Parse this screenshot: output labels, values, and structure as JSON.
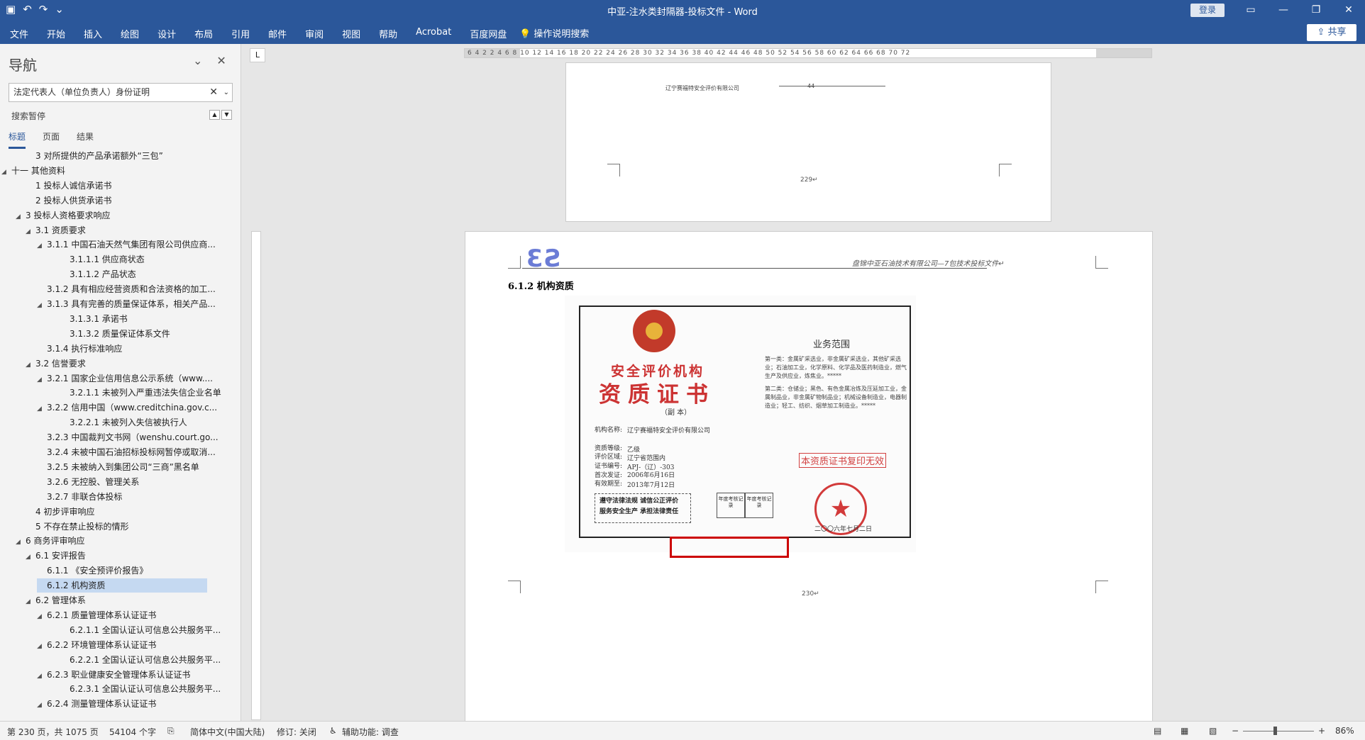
{
  "titlebar": {
    "title": "中亚-注水类封隔器-投标文件  -  Word",
    "login": "登录",
    "qat_icons": [
      "save-icon",
      "undo-icon",
      "redo-icon",
      "customize-icon"
    ],
    "controls": [
      "ribbon-display-icon",
      "minimize-icon",
      "restore-icon",
      "close-icon"
    ]
  },
  "ribbon": {
    "tabs": [
      "文件",
      "开始",
      "插入",
      "绘图",
      "设计",
      "布局",
      "引用",
      "邮件",
      "审阅",
      "视图",
      "帮助",
      "Acrobat",
      "百度网盘"
    ],
    "tellme": "操作说明搜索",
    "share": "共享"
  },
  "nav": {
    "title": "导航",
    "search_value": "法定代表人（单位负责人）身份证明",
    "paused": "搜索暂停",
    "tabs": [
      "标题",
      "页面",
      "结果"
    ],
    "items": [
      {
        "label": "3 对所提供的产品承诺额外“三包”"
      },
      {
        "label": "十一 其他资料"
      },
      {
        "label": "1 投标人诚信承诺书"
      },
      {
        "label": "2 投标人供货承诺书"
      },
      {
        "label": "3 投标人资格要求响应"
      },
      {
        "label": "3.1 资质要求"
      },
      {
        "label": "3.1.1 中国石油天然气集团有限公司供应商..."
      },
      {
        "label": "3.1.1.1 供应商状态"
      },
      {
        "label": "3.1.1.2 产品状态"
      },
      {
        "label": "3.1.2 具有相应经营资质和合法资格的加工..."
      },
      {
        "label": "3.1.3 具有完善的质量保证体系，相关产品..."
      },
      {
        "label": "3.1.3.1 承诺书"
      },
      {
        "label": "3.1.3.2 质量保证体系文件"
      },
      {
        "label": "3.1.4 执行标准响应"
      },
      {
        "label": "3.2 信誉要求"
      },
      {
        "label": "3.2.1 国家企业信用信息公示系统（www...."
      },
      {
        "label": "3.2.1.1 未被列入严重违法失信企业名单"
      },
      {
        "label": "3.2.2 信用中国（www.creditchina.gov.c..."
      },
      {
        "label": "3.2.2.1 未被列入失信被执行人"
      },
      {
        "label": "3.2.3 中国裁判文书网（wenshu.court.go..."
      },
      {
        "label": "3.2.4 未被中国石油招标投标网暂停或取消..."
      },
      {
        "label": "3.2.5 未被纳入到集团公司“三商”黑名单"
      },
      {
        "label": "3.2.6 无控股、管理关系"
      },
      {
        "label": "3.2.7 非联合体投标"
      },
      {
        "label": "4 初步评审响应"
      },
      {
        "label": "5 不存在禁止投标的情形"
      },
      {
        "label": "6 商务评审响应"
      },
      {
        "label": "6.1 安评报告"
      },
      {
        "label": "6.1.1 《安全预评价报告》"
      },
      {
        "label": "6.1.2 机构资质"
      },
      {
        "label": "6.2 管理体系"
      },
      {
        "label": "6.2.1 质量管理体系认证证书"
      },
      {
        "label": "6.2.1.1 全国认证认可信息公共服务平..."
      },
      {
        "label": "6.2.2 环境管理体系认证证书"
      },
      {
        "label": "6.2.2.1 全国认证认可信息公共服务平..."
      },
      {
        "label": "6.2.3 职业健康安全管理体系认证证书"
      },
      {
        "label": "6.2.3.1 全国认证认可信息公共服务平..."
      },
      {
        "label": "6.2.4 测量管理体系认证证书"
      }
    ]
  },
  "ruler": {
    "corner": "L",
    "nums": "6   4   2       2   4   6   8   10  12  14  16  18  20  22  24  26  28  30  32  34  36  38  40  42  44  46  48  50  52  54  56  58  60  62  64  66  68  70  72"
  },
  "page_top": {
    "company": "辽宁赛福特安全评价有限公司",
    "marker": "44",
    "page_num": "229↵"
  },
  "page_main": {
    "logo": "ƐƧ",
    "header_text": "盘锦中亚石油技术有限公司—7包技术投标文件↵",
    "section": "6.1.2 机构资质",
    "page_num": "230↵",
    "cert": {
      "title_small": "安全评价机构",
      "title_big": "资质证书",
      "copy": "（副  本）",
      "org_label": "机构名称:",
      "org_value": "辽宁赛福特安全评价有限公司",
      "level_label": "资质等级:",
      "level_value": "乙级",
      "area_label": "评价区域:",
      "area_value": "辽宁省范围内",
      "cert_label": "证书编号:",
      "cert_value": "APJ-（辽）-303",
      "first_label": "首次发证:",
      "first_value": "2006年6月16日",
      "valid_label": "有效期至:",
      "valid_value": "2013年7月12日",
      "scope_title": "业务范围",
      "scope_1": "第一类：金属矿采选业，非金属矿采选业，其他矿采选业；石油加工业，化学原料、化学品及医药制造业，燃气生产及供应业，炼焦业。*****",
      "scope_2": "第二类：仓储业；黑色、有色金属冶炼及压延加工业，金属制品业，非金属矿物制品业；机械设备制造业，电器制造业；轻工、纺织、烟草加工制造业。*****",
      "stamp_text": "本资质证书复印无效",
      "motto_1": "遵守法律法规  诚信公正评价",
      "motto_2": "服务安全生产  承担法律责任",
      "annual": "年度考核记录",
      "date": "二〇〇六年七月二日"
    }
  },
  "status": {
    "page": "第 230 页，共 1075 页",
    "words": "54104 个字",
    "lang": "简体中文(中国大陆)",
    "revisions": "修订: 关闭",
    "accessibility": "辅助功能: 调查",
    "zoom": "86%"
  }
}
